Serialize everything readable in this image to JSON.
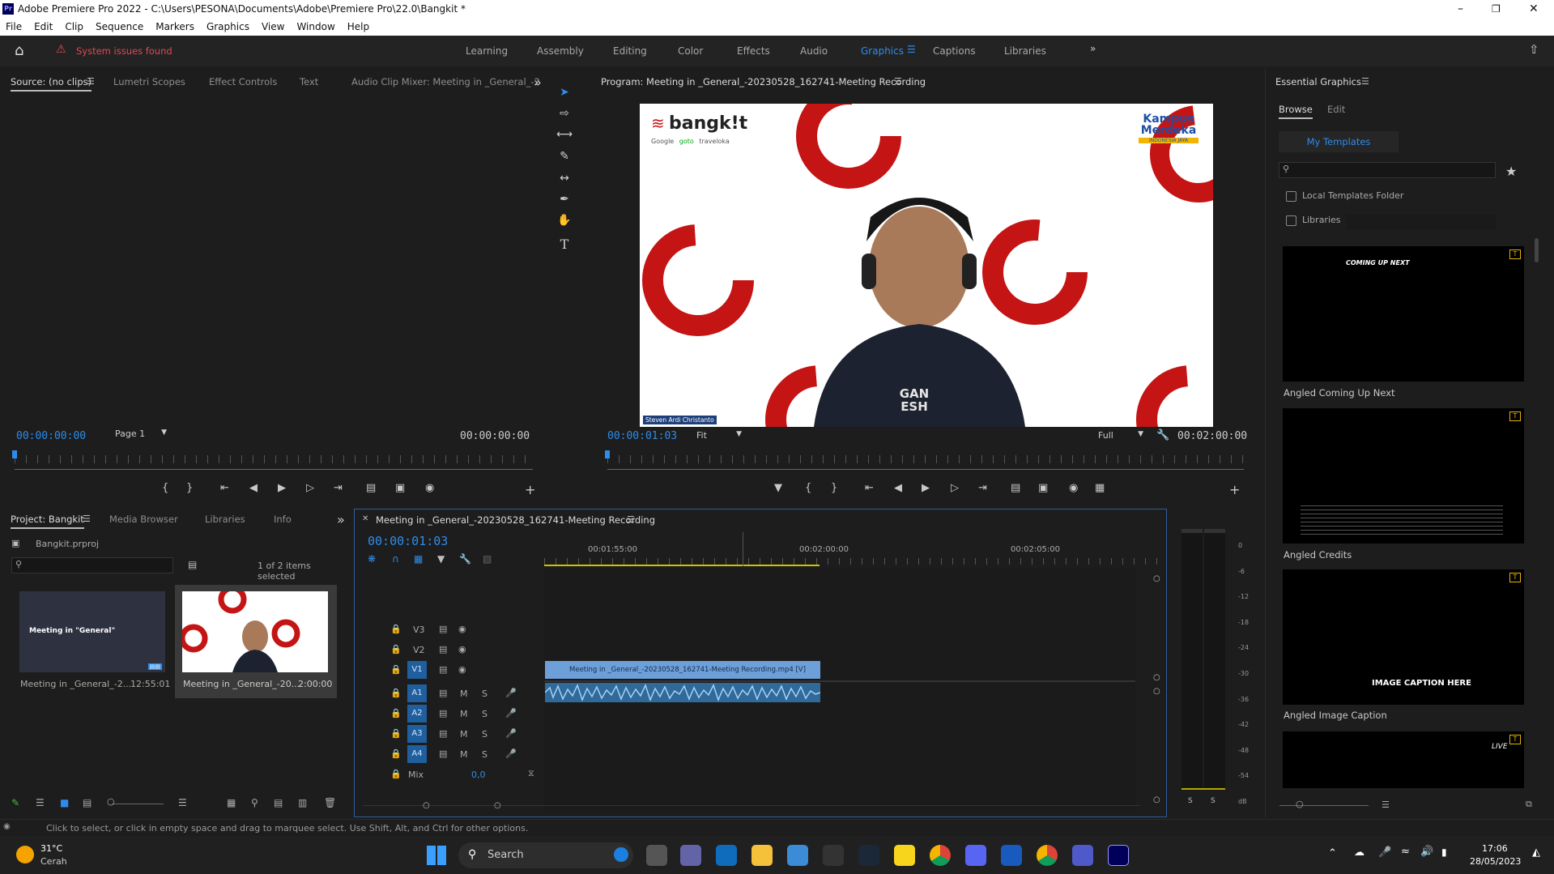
{
  "app": {
    "title": "Adobe Premiere Pro 2022 - C:\\Users\\PESONA\\Documents\\Adobe\\Premiere Pro\\22.0\\Bangkit *",
    "icon_text": "Pr"
  },
  "menu": [
    "File",
    "Edit",
    "Clip",
    "Sequence",
    "Markers",
    "Graphics",
    "View",
    "Window",
    "Help"
  ],
  "workspace": {
    "warning": "System issues found",
    "tabs": [
      "Learning",
      "Assembly",
      "Editing",
      "Color",
      "Effects",
      "Audio",
      "Graphics",
      "Captions",
      "Libraries"
    ],
    "active": "Graphics"
  },
  "source_panel": {
    "tabs": [
      "Source: (no clips)",
      "Lumetri Scopes",
      "Effect Controls",
      "Text",
      "Audio Clip Mixer: Meeting in _General_-2"
    ],
    "timecode_in": "00:00:00:00",
    "page": "Page 1",
    "timecode_out": "00:00:00:00"
  },
  "program_panel": {
    "title": "Program: Meeting in _General_-20230528_162741-Meeting Recording",
    "timecode": "00:00:01:03",
    "fit": "Fit",
    "quality": "Full",
    "duration": "00:02:00:00",
    "video": {
      "logo_text": "bangk!t",
      "sponsors": [
        "Google",
        "goto",
        "traveloka"
      ],
      "right_logo": "Kampus Merdeka",
      "right_logo_sub": "INDONESIA JAYA",
      "shirt_text": "GAN ESH",
      "name_tag": "Steven Ardi Christanto"
    }
  },
  "project_panel": {
    "tabs": [
      "Project: Bangkit",
      "Media Browser",
      "Libraries",
      "Info"
    ],
    "file": "Bangkit.prproj",
    "selection": "1 of 2 items selected",
    "items": [
      {
        "name": "Meeting in _General_-2...",
        "duration": "12:55:01",
        "thumb_title": "Meeting in \"General\""
      },
      {
        "name": "Meeting in _General_-20...",
        "duration": "2:00:00"
      }
    ]
  },
  "timeline": {
    "title": "Meeting in _General_-20230528_162741-Meeting Recording",
    "timecode": "00:00:01:03",
    "ruler": [
      "00:01:55:00",
      "00:02:00:00",
      "00:02:05:00"
    ],
    "video_tracks": [
      "V3",
      "V2",
      "V1"
    ],
    "audio_tracks": [
      "A1",
      "A2",
      "A3",
      "A4"
    ],
    "mix_label": "Mix",
    "mix_value": "0,0",
    "clip_label": "Meeting in _General_-20230528_162741-Meeting Recording.mp4 [V]",
    "mute": "M",
    "solo": "S"
  },
  "meter": {
    "scale": [
      "0",
      "-6",
      "-12",
      "-18",
      "-24",
      "-30",
      "-36",
      "-42",
      "-48",
      "-54",
      "dB"
    ],
    "solo": [
      "S",
      "S"
    ]
  },
  "essential_graphics": {
    "title": "Essential Graphics",
    "tabs": [
      "Browse",
      "Edit"
    ],
    "templates_button": "My Templates",
    "local_folder": "Local Templates Folder",
    "libraries": "Libraries",
    "templates": [
      {
        "name": "Angled Coming Up Next",
        "preview": "COMING UP NEXT"
      },
      {
        "name": "Angled Credits",
        "preview": ""
      },
      {
        "name": "Angled Image Caption",
        "preview": "IMAGE CAPTION HERE"
      },
      {
        "name": "",
        "preview": "LIVE"
      }
    ]
  },
  "status": {
    "message": "Click to select, or click in empty space and drag to marquee select. Use Shift, Alt, and Ctrl for other options."
  },
  "taskbar": {
    "weather_temp": "31°C",
    "weather_desc": "Cerah",
    "search": "Search",
    "time": "17:06",
    "date": "28/05/2023"
  },
  "colors": {
    "accent": "#2d8ceb",
    "warning": "#e34850",
    "clip_video": "#6d9fd8",
    "clip_audio": "#2f6a9a",
    "track_label": "#1f5f9d",
    "brand_red": "#c41414"
  }
}
